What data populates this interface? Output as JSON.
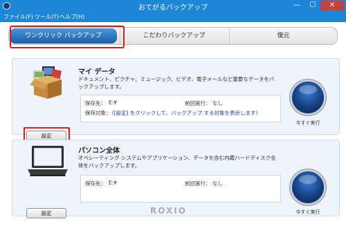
{
  "window": {
    "title": "おてがるバックアップ",
    "controls": {
      "minimize": "—",
      "maximize": "☐",
      "close": "✕"
    }
  },
  "menu": {
    "file": "ファイル(F)",
    "tools": "ツール(T)",
    "help": "ヘルプ(H)"
  },
  "tabs": {
    "one_click": "ワンクリック バックアップ",
    "custom": "こだわりバックアップ",
    "restore": "復元"
  },
  "my_data": {
    "title": "マイ データ",
    "description": "ドキュメント、ピクチャ、ミュージック、ビデオ、電子メールなど重要なデータをバックアップします。",
    "destination_label": "保存先：",
    "destination_value": "E:¥",
    "last_run_label": "前回実行：",
    "last_run_value": "なし",
    "target_label": "保存対象：",
    "target_link": "（[設定] をクリックして、バックアップ する対象を表示します）",
    "settings_button": "設定",
    "run_label": "今すぐ実行"
  },
  "pc": {
    "title": "パソコン全体",
    "description": "オペレーティング システムやアプリケーション、データを含む内蔵ハードディスク全体をバックアップします。",
    "destination_label": "保存先：",
    "destination_value": "E:¥",
    "last_run_label": "前回実行：",
    "last_run_value": "なし",
    "settings_button": "設定",
    "run_label": "今すぐ実行"
  },
  "footer": {
    "logo": "ROXIO"
  },
  "colors": {
    "titlebar": "#1e86d6",
    "close": "#c7403a",
    "active_tab": "#1c5ca8",
    "highlight": "#e01818",
    "panel": "#eef4fb",
    "link": "#1a3fc0"
  }
}
